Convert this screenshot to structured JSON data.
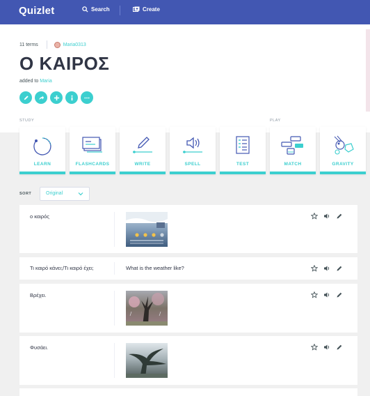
{
  "topbar": {
    "logo": "Quizlet",
    "search_label": "Search",
    "create_label": "Create"
  },
  "set": {
    "terms_count": "11 terms",
    "author": "Maria0313",
    "title": "Ο ΚΑΙΡΟΣ",
    "added_prefix": "added to",
    "added_class": "Maria"
  },
  "actions": [
    "edit-icon",
    "share-icon",
    "add-icon",
    "info-icon",
    "more-icon"
  ],
  "sections": {
    "study": "STUDY",
    "play": "PLAY"
  },
  "study_modes": [
    {
      "label": "LEARN",
      "icon": "learn-icon"
    },
    {
      "label": "FLASHCARDS",
      "icon": "flashcards-icon"
    },
    {
      "label": "WRITE",
      "icon": "write-icon"
    },
    {
      "label": "SPELL",
      "icon": "spell-icon"
    },
    {
      "label": "TEST",
      "icon": "test-icon"
    },
    {
      "label": "MATCH",
      "icon": "match-icon"
    },
    {
      "label": "GRAVITY",
      "icon": "gravity-icon"
    }
  ],
  "sort": {
    "label": "SORT",
    "value": "Original"
  },
  "terms": [
    {
      "term": "ο καιρός",
      "definition": "",
      "image": "weather-forecast"
    },
    {
      "term": "Τι καιρό κάνει;/Τι καιρό έχει;",
      "definition": "What is the weather like?",
      "image": ""
    },
    {
      "term": "Βρέχει.",
      "definition": "",
      "image": "rain"
    },
    {
      "term": "Φυσάει.",
      "definition": "",
      "image": "wind"
    }
  ],
  "colors": {
    "brand": "#4257b2",
    "accent": "#3ccfcf",
    "text": "#303545"
  }
}
